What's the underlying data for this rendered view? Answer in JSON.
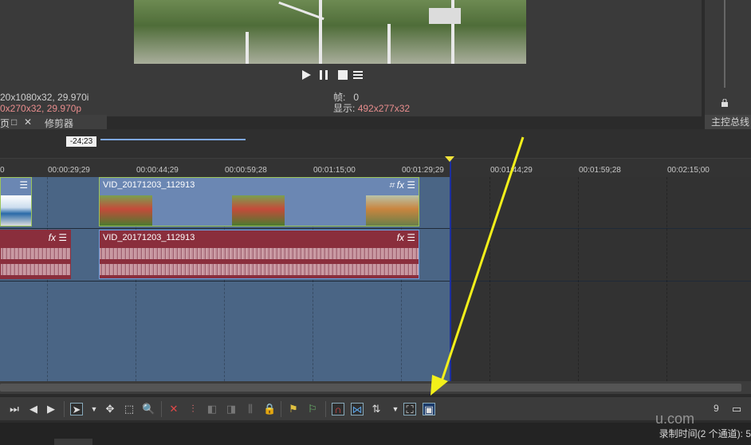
{
  "preview": {
    "project_props": "20x1080x32, 29.970i",
    "preview_props": "0x270x32, 29.970p",
    "frame_label": "帧:",
    "frame_value": "0",
    "display_label": "显示:",
    "display_value": "492x277x32"
  },
  "tabs": {
    "trimmer": "修剪器"
  },
  "master": {
    "label": "主控总线"
  },
  "timeline": {
    "time_badge": "-24;23",
    "ruler_ticks": [
      "00:00:29;29",
      "00:00:44;29",
      "00:00:59;28",
      "00:01:15;00",
      "00:01:29;29",
      "00:01:44;29",
      "00:01:59;28",
      "00:02:15;00"
    ],
    "video_clip_title": "VID_20171203_112913",
    "audio_clip_title": "VID_20171203_112913",
    "fx_label": "fx"
  },
  "status": {
    "record_time": "录制时间(2 个通道): 5",
    "watermark": "u.com",
    "right_num": "9"
  },
  "colors": {
    "accent_arrow": "#f3f01a",
    "selected_track": "#4a6585",
    "audio_clip": "#8a2e3c",
    "video_clip": "#6b87b3",
    "playhead": "#1c2fa0"
  }
}
